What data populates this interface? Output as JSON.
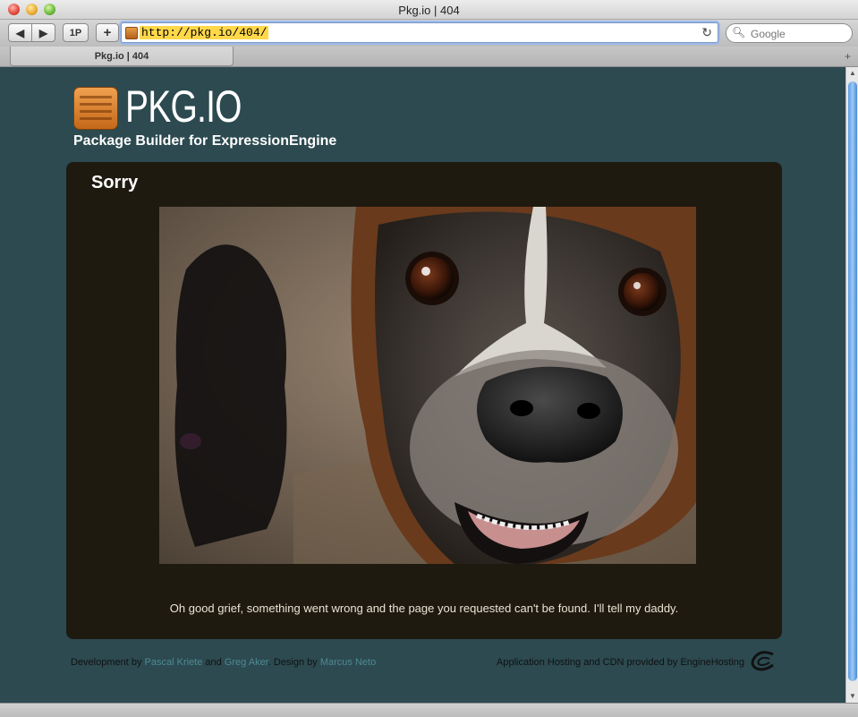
{
  "window": {
    "title": "Pkg.io | 404"
  },
  "toolbar": {
    "back_icon": "◀",
    "forward_icon": "▶",
    "snapback_label": "1P",
    "add_label": "+",
    "url": "http://pkg.io/404/",
    "reload_icon": "↻",
    "search_placeholder": "Google"
  },
  "tab": {
    "label": "Pkg.io | 404"
  },
  "site": {
    "logo_text": "PKG.IO",
    "tagline": "Package Builder for ExpressionEngine"
  },
  "panel": {
    "heading": "Sorry",
    "message": "Oh good grief, something went wrong and the page you requested can't be found. I'll tell my daddy."
  },
  "footer": {
    "dev_prefix": "Development by ",
    "dev_name_1": "Pascal Kriete",
    "and": " and ",
    "dev_name_2": "Greg Aker",
    "design_prefix": ". Design by ",
    "designer": "Marcus Neto",
    "hosting": "Application Hosting and CDN provided by EngineHosting"
  },
  "colors": {
    "page_bg": "#2c4a50",
    "panel_bg": "#1e1a10",
    "link": "#4f8994",
    "logo_orange": "#d87d2a"
  }
}
